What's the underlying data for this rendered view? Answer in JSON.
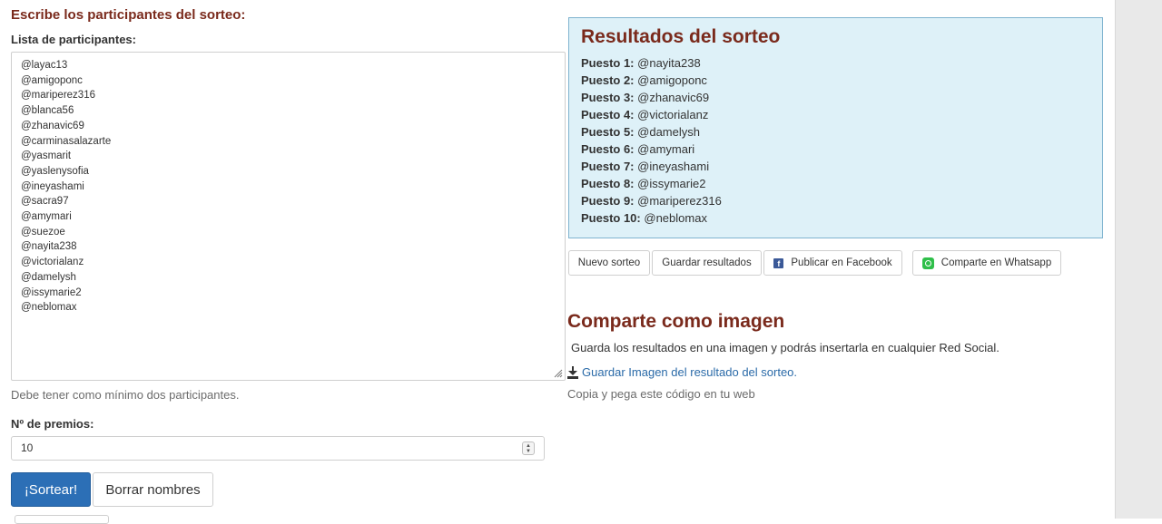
{
  "left": {
    "heading": "Escribe los participantes del sorteo:",
    "list_label": "Lista de participantes:",
    "participants": [
      "@layac13",
      "@amigoponc",
      "@mariperez316",
      "@blanca56",
      "@zhanavic69",
      "@carminasalazarte",
      "@yasmarit",
      "@yaslenysofia",
      "@ineyashami",
      "@sacra97",
      "@amymari",
      "@suezoe",
      "@nayita238",
      "@victorialanz",
      "@damelysh",
      "@issymarie2",
      "@neblomax"
    ],
    "hint": "Debe tener como mínimo dos participantes.",
    "prizes_label": "Nº de premios:",
    "prizes_value": "10",
    "draw_button": "¡Sortear!",
    "clear_button": "Borrar nombres"
  },
  "results": {
    "title": "Resultados del sorteo",
    "items": [
      {
        "place": "Puesto 1:",
        "name": "@nayita238"
      },
      {
        "place": "Puesto 2:",
        "name": "@amigoponc"
      },
      {
        "place": "Puesto 3:",
        "name": "@zhanavic69"
      },
      {
        "place": "Puesto 4:",
        "name": "@victorialanz"
      },
      {
        "place": "Puesto 5:",
        "name": "@damelysh"
      },
      {
        "place": "Puesto 6:",
        "name": "@amymari"
      },
      {
        "place": "Puesto 7:",
        "name": "@ineyashami"
      },
      {
        "place": "Puesto 8:",
        "name": "@issymarie2"
      },
      {
        "place": "Puesto 9:",
        "name": "@mariperez316"
      },
      {
        "place": "Puesto 10:",
        "name": "@neblomax"
      }
    ]
  },
  "actions": {
    "new_draw": "Nuevo sorteo",
    "save_results": "Guardar resultados",
    "facebook": "Publicar en Facebook",
    "whatsapp": "Comparte en Whatsapp"
  },
  "share_image": {
    "heading": "Comparte como imagen",
    "description": "Guarda los resultados en una imagen y podrás insertarla en cualquier Red Social.",
    "link": "Guardar Imagen del resultado del sorteo.",
    "embed_text": "Copia y pega este código en tu web"
  },
  "colors": {
    "heading": "#7a2a1c",
    "primary_button": "#2c6fb6",
    "results_bg": "#def1f8",
    "link": "#2a6aa8"
  }
}
